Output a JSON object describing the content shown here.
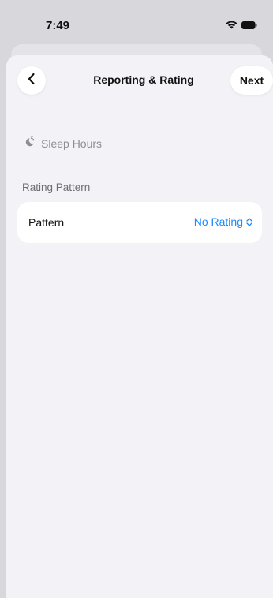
{
  "status_bar": {
    "time": "7:49",
    "signal_dots": "....",
    "icons": [
      "wifi-icon",
      "battery-icon"
    ]
  },
  "nav": {
    "title": "Reporting & Rating",
    "back_icon": "chevron-left-icon",
    "next_label": "Next"
  },
  "metric": {
    "icon": "sleep-moon-icon",
    "label": "Sleep Hours"
  },
  "section": {
    "header": "Rating Pattern",
    "rows": [
      {
        "label": "Pattern",
        "value": "No Rating",
        "value_icon": "chevron-up-down-icon"
      }
    ]
  },
  "colors": {
    "accent": "#1a8cff",
    "background": "#f2f2f7",
    "card": "#ffffff",
    "secondary_text": "#8e8e93",
    "status_bar_bg": "#d7d7dc"
  }
}
